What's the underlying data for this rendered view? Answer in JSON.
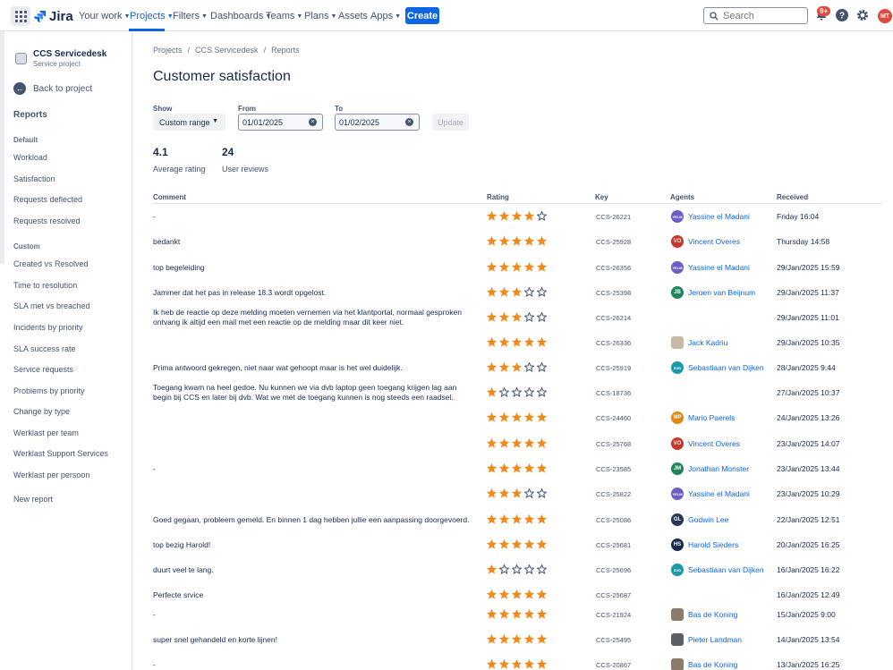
{
  "topnav": {
    "logo": "Jira",
    "items": [
      "Your work",
      "Projects",
      "Filters",
      "Dashboards",
      "Teams",
      "Plans",
      "Assets",
      "Apps"
    ],
    "create": "Create",
    "search_placeholder": "Search",
    "notif_badge": "9+",
    "user_initials": "MT"
  },
  "sidebar": {
    "project_name": "CCS Servicedesk",
    "project_type": "Service project",
    "back": "Back to project",
    "reports_heading": "Reports",
    "default_heading": "Default",
    "default_items": [
      "Workload",
      "Satisfaction",
      "Requests deflected",
      "Requests resolved"
    ],
    "custom_heading": "Custom",
    "custom_items": [
      "Created vs Resolved",
      "Time to resolution",
      "SLA met vs breached",
      "Incidents by priority",
      "SLA success rate",
      "Service requests",
      "Problems by priority",
      "Change by type",
      "Werklast per team",
      "Werklast Support Services",
      "Werklast per persoon"
    ],
    "new_report": "New report"
  },
  "breadcrumbs": [
    "Projects",
    "/",
    "CCS Servicedesk",
    "/",
    "Reports"
  ],
  "page_title": "Customer satisfaction",
  "filters": {
    "show_label": "Show",
    "show_value": "Custom range",
    "from_label": "From",
    "from_value": "01/01/2025",
    "to_label": "To",
    "to_value": "01/02/2025",
    "update": "Update"
  },
  "stats": {
    "avg_value": "4.1",
    "avg_label": "Average rating",
    "reviews_value": "24",
    "reviews_label": "User reviews"
  },
  "table": {
    "headers": [
      "Comment",
      "Rating",
      "Key",
      "Agents",
      "Received"
    ],
    "rows": [
      {
        "comment": "-",
        "rating": 4,
        "key": "CCS-26221",
        "agent": "Yassine el Madani",
        "initials": "YELM",
        "ava_color": "#6e5dc6",
        "received": "Friday 16:04"
      },
      {
        "comment": "bedankt",
        "rating": 5,
        "key": "CCS-25928",
        "agent": "Vincent Overes",
        "initials": "VO",
        "ava_color": "#c9372c",
        "received": "Thursday 14:58"
      },
      {
        "comment": "top begeleiding",
        "rating": 5,
        "key": "CCS-26356",
        "agent": "Yassine el Madani",
        "initials": "YELM",
        "ava_color": "#6e5dc6",
        "received": "29/Jan/2025 15:59"
      },
      {
        "comment": "Jammer dat het pas in release 18.3 wordt opgelost.",
        "rating": 3,
        "key": "CCS-25398",
        "agent": "Jeroen van Beijnum",
        "initials": "JB",
        "ava_color": "#1f845a",
        "received": "29/Jan/2025 11:37"
      },
      {
        "comment": "Ik heb de reactie op deze melding moeten vernemen via het klantportal, normaal gesproken ontvang ik altijd een mail met een reactie op de melding maar dit keer niet.",
        "rating": 3,
        "key": "CCS-26214",
        "agent": "",
        "initials": "",
        "ava_color": "",
        "received": "29/Jan/2025 11:01"
      },
      {
        "comment": "",
        "rating": 5,
        "key": "CCS-26336",
        "agent": "Jack Kadriu",
        "initials": "",
        "ava_color": "#c7b9a4",
        "received": "29/Jan/2025 10:35"
      },
      {
        "comment": "Prima antwoord gekregen, niet naar wat gehoopt maar is het wel duidelijk.",
        "rating": 3,
        "key": "CCS-25919",
        "agent": "Sebastiaan van Dijken",
        "initials": "SVD",
        "ava_color": "#1d9aaa",
        "received": "28/Jan/2025 9:44"
      },
      {
        "comment": "Toegang kwam na heel gedoe. Nu kunnen we via dvb laptop geen toegang krijgen lag aan begin bij CCS en later bij dvb. Wat we met de toegang kunnen is nog steeds een raadsel.",
        "rating": 1,
        "key": "CCS-18736",
        "agent": "",
        "initials": "",
        "ava_color": "",
        "received": "27/Jan/2025 10:37"
      },
      {
        "comment": "",
        "rating": 5,
        "key": "CCS-24460",
        "agent": "Mario Paerels",
        "initials": "MP",
        "ava_color": "#e2870f",
        "received": "24/Jan/2025 13:26"
      },
      {
        "comment": "",
        "rating": 5,
        "key": "CCS-25768",
        "agent": "Vincent Overes",
        "initials": "VO",
        "ava_color": "#c9372c",
        "received": "23/Jan/2025 14:07"
      },
      {
        "comment": "-",
        "rating": 5,
        "key": "CCS-23585",
        "agent": "Jonathan Monster",
        "initials": "JM",
        "ava_color": "#1f845a",
        "received": "23/Jan/2025 13:44"
      },
      {
        "comment": "",
        "rating": 3,
        "key": "CCS-25822",
        "agent": "Yassine el Madani",
        "initials": "YELM",
        "ava_color": "#6e5dc6",
        "received": "23/Jan/2025 10:29"
      },
      {
        "comment": "Goed gegaan, probleem gemeld. En binnen 1 dag hebben jullie een aanpassing doorgevoerd.",
        "rating": 5,
        "key": "CCS-25086",
        "agent": "Godwin Lee",
        "initials": "GL",
        "ava_color": "#253858",
        "received": "22/Jan/2025 12:51"
      },
      {
        "comment": "top bezig Harold!",
        "rating": 5,
        "key": "CCS-25681",
        "agent": "Harold Sieders",
        "initials": "HS",
        "ava_color": "#172b4d",
        "received": "20/Jan/2025 16:25"
      },
      {
        "comment": "duurt veel te lang.",
        "rating": 1,
        "key": "CCS-25696",
        "agent": "Sebastiaan van Dijken",
        "initials": "SVD",
        "ava_color": "#1d9aaa",
        "received": "16/Jan/2025 16:22"
      },
      {
        "comment": "Perfecte srvice",
        "rating": 5,
        "key": "CCS-25687",
        "agent": "",
        "initials": "",
        "ava_color": "",
        "received": "16/Jan/2025 12:49"
      },
      {
        "comment": "-",
        "rating": 5,
        "key": "CCS-21924",
        "agent": "Bas de Koning",
        "initials": "",
        "ava_color": "#8c7b6b",
        "received": "15/Jan/2025 9:00"
      },
      {
        "comment": "super snel gehandeld en korte lijnen!",
        "rating": 5,
        "key": "CCS-25495",
        "agent": "Pieter Landman",
        "initials": "",
        "ava_color": "#5b5f66",
        "received": "14/Jan/2025 13:54"
      },
      {
        "comment": "-",
        "rating": 5,
        "key": "CCS-20867",
        "agent": "Bas de Koning",
        "initials": "",
        "ava_color": "#8c7b6b",
        "received": "13/Jan/2025 16:25"
      }
    ]
  },
  "colors": {
    "star_filled": "#f18a1d",
    "star_empty_stroke": "#44546f",
    "link": "#0c66e4",
    "brand": "#0c66e4"
  }
}
